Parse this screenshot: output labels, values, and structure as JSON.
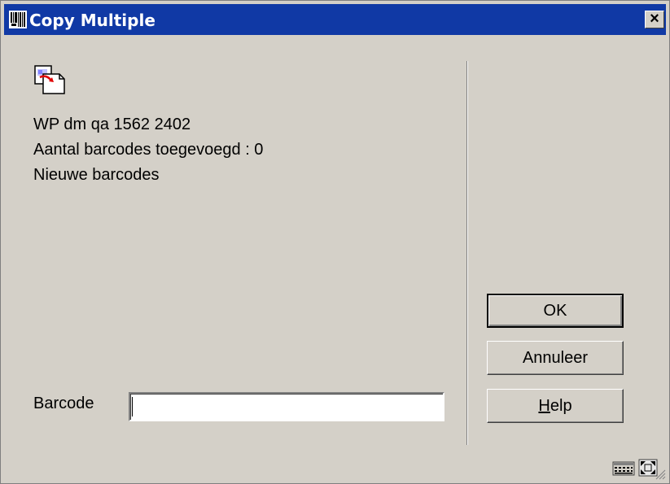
{
  "window": {
    "title": "Copy Multiple",
    "close_label": "×",
    "title_icon": "app-barcode-icon"
  },
  "main": {
    "doc_icon": "copy-document-icon",
    "info_lines": [
      "WP dm qa 1562 2402",
      "Aantal barcodes toegevoegd : 0",
      "Nieuwe barcodes"
    ],
    "barcode_label": "Barcode",
    "barcode_value": ""
  },
  "buttons": {
    "ok": "OK",
    "cancel": "Annuleer",
    "help_accel": "H",
    "help_rest": "elp"
  },
  "status": {
    "icons": [
      "keyboard-grid-icon",
      "fullscreen-icon"
    ]
  },
  "colors": {
    "titlebar": "#1039a5",
    "dialog_bg": "#d4d0c8"
  }
}
